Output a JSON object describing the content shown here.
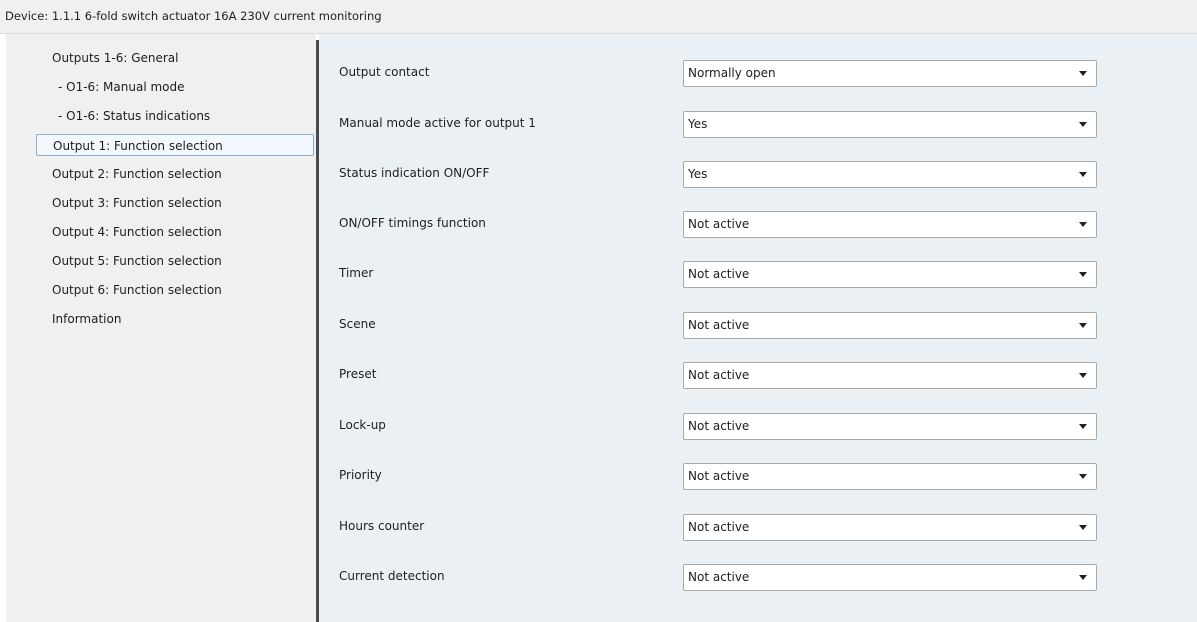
{
  "title": "Device: 1.1.1  6-fold switch actuator 16A 230V current monitoring",
  "sidebar": {
    "items": [
      {
        "label": "Outputs 1-6: General"
      },
      {
        "label": "- O1-6: Manual mode"
      },
      {
        "label": "- O1-6: Status indications"
      },
      {
        "label": "Output 1: Function selection"
      },
      {
        "label": "Output 2: Function selection"
      },
      {
        "label": "Output 3: Function selection"
      },
      {
        "label": "Output 4: Function selection"
      },
      {
        "label": "Output 5: Function selection"
      },
      {
        "label": "Output 6: Function selection"
      },
      {
        "label": "Information"
      }
    ]
  },
  "params": [
    {
      "label": "Output contact",
      "value": "Normally open"
    },
    {
      "label": "Manual mode active for output 1",
      "value": "Yes"
    },
    {
      "label": "Status indication ON/OFF",
      "value": "Yes"
    },
    {
      "label": "ON/OFF timings function",
      "value": "Not active"
    },
    {
      "label": "Timer",
      "value": "Not active"
    },
    {
      "label": "Scene",
      "value": "Not active"
    },
    {
      "label": "Preset",
      "value": "Not active"
    },
    {
      "label": "Lock-up",
      "value": "Not active"
    },
    {
      "label": "Priority",
      "value": "Not active"
    },
    {
      "label": "Hours counter",
      "value": "Not active"
    },
    {
      "label": "Current detection",
      "value": "Not active"
    }
  ]
}
